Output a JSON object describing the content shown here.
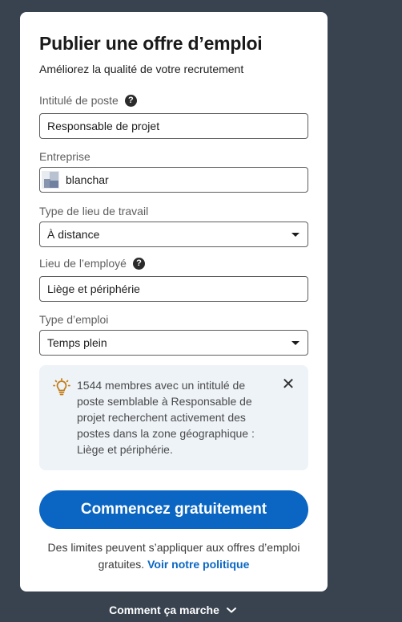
{
  "card": {
    "title": "Publier une offre d’emploi",
    "subtitle": "Améliorez la qualité de votre recrutement"
  },
  "fields": {
    "job_title": {
      "label": "Intitulé de poste",
      "value": "Responsable de projet"
    },
    "company": {
      "label": "Entreprise",
      "value": "blanchar"
    },
    "workplace_type": {
      "label": "Type de lieu de travail",
      "value": "À distance"
    },
    "employee_location": {
      "label": "Lieu de l’employé",
      "value": "Liège et périphérie"
    },
    "job_type": {
      "label": "Type d’emploi",
      "value": "Temps plein"
    }
  },
  "help_glyph": "?",
  "info": {
    "text": "1544 membres avec un intitulé de poste semblable à Responsable de projet recherchent activement des postes dans la zone géographique : Liège et périphérie.",
    "close_glyph": "✕",
    "icon": "lightbulb-icon",
    "icon_color": "#c37d16"
  },
  "cta": {
    "label": "Commencez gratuitement",
    "color": "#0a66c2"
  },
  "footnote": {
    "text": "Des limites peuvent s’appliquer aux offres d’emploi gratuites.",
    "link": "Voir notre politique"
  },
  "how_it_works": {
    "label": "Comment ça marche"
  }
}
